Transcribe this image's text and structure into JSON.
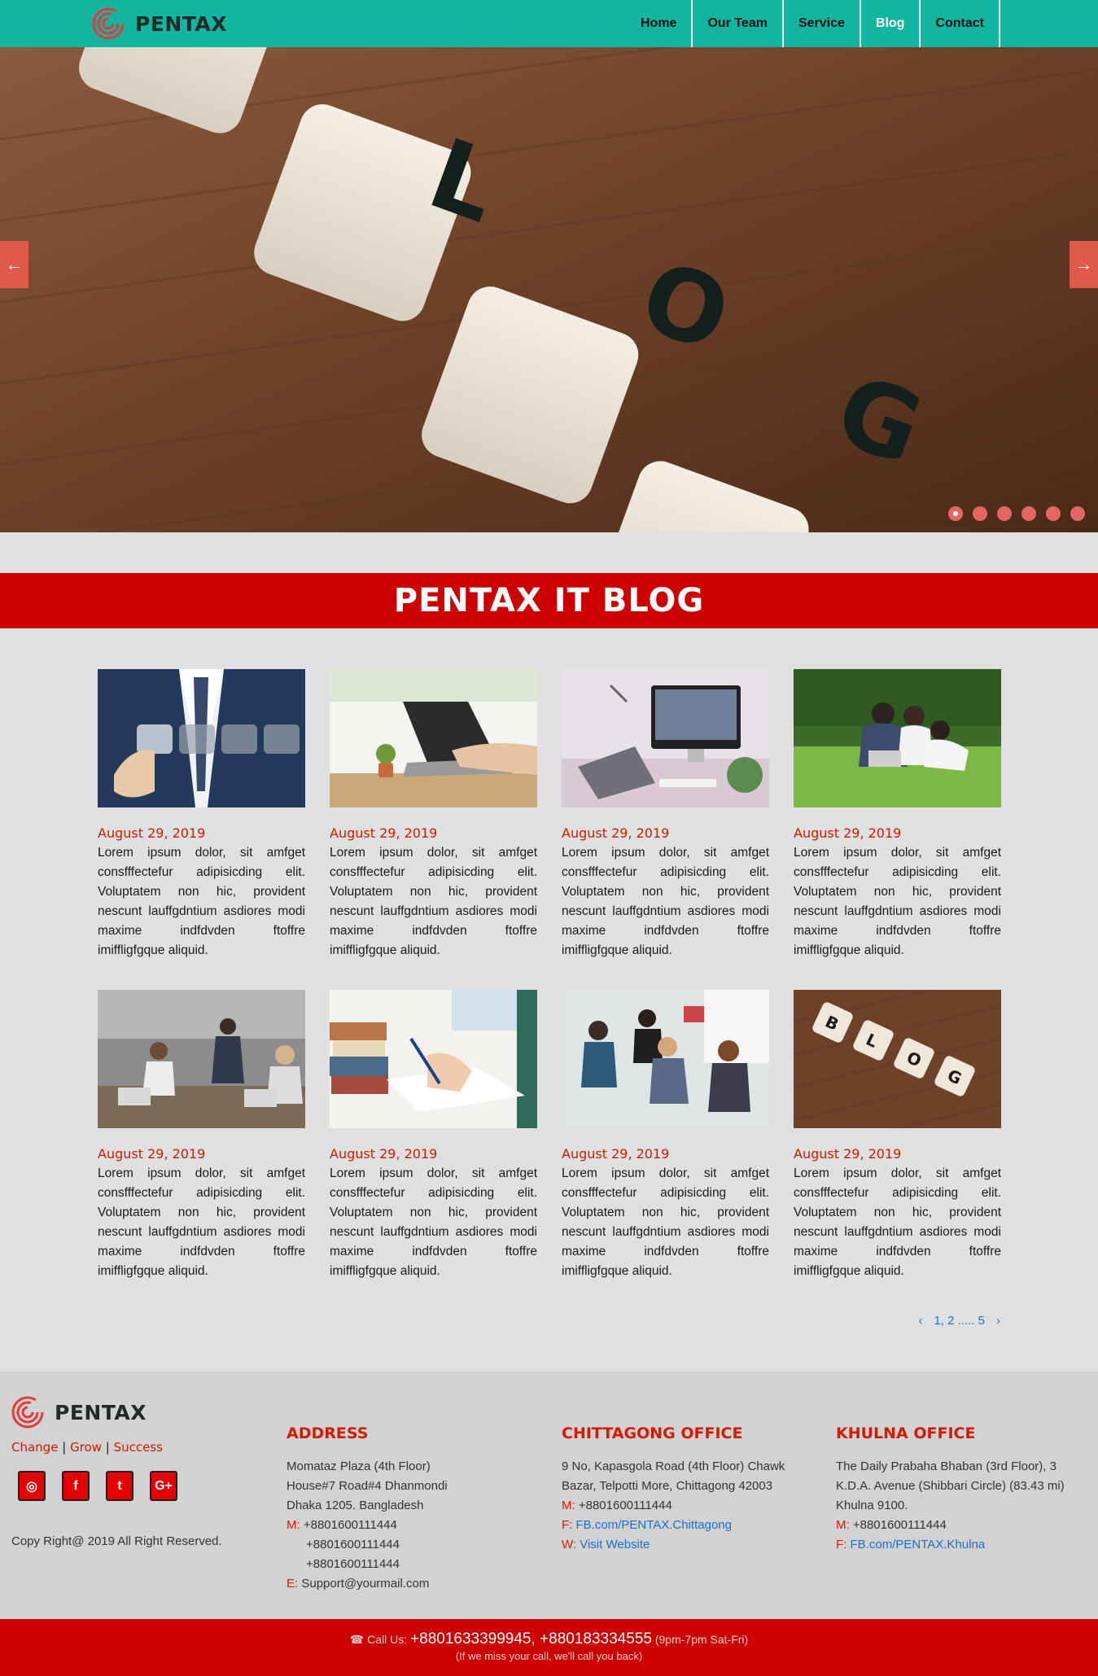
{
  "header": {
    "logo_text": "PENTAX",
    "nav": [
      {
        "label": "Home"
      },
      {
        "label": "Our Team"
      },
      {
        "label": "Service"
      },
      {
        "label": "Blog",
        "active": true
      },
      {
        "label": "Contact"
      }
    ]
  },
  "hero": {
    "tiles": [
      "L",
      "O",
      "G"
    ],
    "arrow_left": "←",
    "arrow_right": "→",
    "slides": 6,
    "active_slide": 1
  },
  "blog": {
    "title": "PENTAX IT BLOG",
    "posts": [
      {
        "date": "August 29, 2019",
        "text": "Lorem ipsum dolor, sit amfget consfffectefur adipisicding elit. Voluptatem non hic, provident nescunt lauffgdntium asdiores modi maxime indfdvden ftoffre imiffligfgque aliquid."
      },
      {
        "date": "August 29, 2019",
        "text": "Lorem ipsum dolor, sit amfget consfffectefur adipisicding elit. Voluptatem non hic, provident nescunt lauffgdntium asdiores modi maxime indfdvden ftoffre imiffligfgque aliquid."
      },
      {
        "date": "August 29, 2019",
        "text": "Lorem ipsum dolor, sit amfget consfffectefur adipisicding elit. Voluptatem non hic, provident nescunt lauffgdntium asdiores modi maxime indfdvden ftoffre imiffligfgque aliquid."
      },
      {
        "date": "August 29, 2019",
        "text": "Lorem ipsum dolor, sit amfget consfffectefur adipisicding elit. Voluptatem non hic, provident nescunt lauffgdntium asdiores modi maxime indfdvden ftoffre imiffligfgque aliquid."
      },
      {
        "date": "August 29, 2019",
        "text": "Lorem ipsum dolor, sit amfget consfffectefur adipisicding elit. Voluptatem non hic, provident nescunt lauffgdntium asdiores modi maxime indfdvden ftoffre imiffligfgque aliquid."
      },
      {
        "date": "August 29, 2019",
        "text": "Lorem ipsum dolor, sit amfget consfffectefur adipisicding elit. Voluptatem non hic, provident nescunt lauffgdntium asdiores modi maxime indfdvden ftoffre imiffligfgque aliquid."
      },
      {
        "date": "August 29, 2019",
        "text": "Lorem ipsum dolor, sit amfget consfffectefur adipisicding elit. Voluptatem non hic, provident nescunt lauffgdntium asdiores modi maxime indfdvden ftoffre imiffligfgque aliquid."
      },
      {
        "date": "August 29, 2019",
        "text": "Lorem ipsum dolor, sit amfget consfffectefur adipisicding elit. Voluptatem non hic, provident nescunt lauffgdntium asdiores modi maxime indfdvden ftoffre imiffligfgque aliquid."
      }
    ],
    "last_post_tiles": [
      "B",
      "L",
      "O",
      "G"
    ],
    "pagination": {
      "prev": "‹",
      "label": "1, 2 ..... 5",
      "next": "›"
    }
  },
  "footer": {
    "logo_text": "PENTAX",
    "tagline": [
      "Change",
      "Grow",
      "Success"
    ],
    "tagline_sep": "|",
    "social": [
      {
        "icon": "instagram-icon",
        "glyph": "◎"
      },
      {
        "icon": "facebook-icon",
        "glyph": "f"
      },
      {
        "icon": "twitter-icon",
        "glyph": "t"
      },
      {
        "icon": "google-plus-icon",
        "glyph": "G+"
      }
    ],
    "copyright": "Copy Right@ 2019 All Right Reserved.",
    "address": {
      "title": "ADDRESS",
      "lines": [
        "Momataz Plaza (4th Floor)",
        "House#7 Road#4 Dhanmondi",
        "Dhaka 1205. Bangladesh"
      ],
      "m_label": "M:",
      "phones": [
        "+8801600111444",
        "+8801600111444",
        "+8801600111444"
      ],
      "e_label": "E:",
      "email": "Support@yourmail.com"
    },
    "chittagong": {
      "title": "CHITTAGONG OFFICE",
      "lines": [
        "9 No, Kapasgola Road (4th Floor) Chawk",
        "Bazar, Telpotti More, Chittagong 42003"
      ],
      "m_label": "M:",
      "phone": "+8801600111444",
      "f_label": "F:",
      "facebook": "FB.com/PENTAX.Chittagong",
      "w_label": "W:",
      "website": "Visit Website"
    },
    "khulna": {
      "title": "KHULNA OFFICE",
      "lines": [
        "The Daily Prabaha Bhaban (3rd Floor), 3",
        "K.D.A. Avenue (Shibbari Circle) (83.43 mi)",
        "Khulna 9100."
      ],
      "m_label": "M:",
      "phone": "+8801600111444",
      "f_label": "F:",
      "facebook": "FB.com/PENTAX.Khulna"
    }
  },
  "callbar": {
    "icon": "phone-icon",
    "prefix": "Call Us:",
    "numbers": "+8801633399945, +880183334555",
    "hours": "(9pm-7pm Sat-Fri)",
    "note": "(If we miss your call, we'll call you back)"
  },
  "colors": {
    "header": "#11b5a0",
    "accent_red": "#cc0000",
    "date_red": "#cc1a00",
    "link_blue": "#1a6fd1",
    "page_bg": "#e0e0e0"
  }
}
